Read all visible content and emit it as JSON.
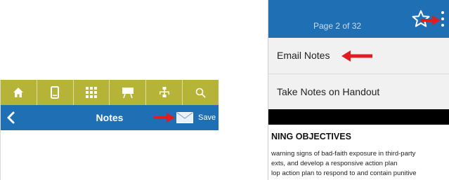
{
  "left_screen": {
    "nav_icons": [
      "home-icon",
      "phone-icon",
      "grid-icon",
      "presentation-icon",
      "tree-icon",
      "search-icon"
    ],
    "title": "Notes",
    "save_label": "Save"
  },
  "right_screen": {
    "page_indicator": "Page 2 of 32",
    "menu": {
      "email_notes": "Email Notes",
      "take_notes_handout": "Take Notes on Handout"
    },
    "document": {
      "heading": "NING OBJECTIVES",
      "lines": [
        "warning signs of bad-faith exposure in third-party",
        "exts, and develop a responsive action plan",
        "lop action plan to respond to and contain punitive"
      ]
    }
  },
  "colors": {
    "nav_olive": "#b5b438",
    "header_blue": "#1f6fb5",
    "annotation_red": "#e11b22"
  }
}
